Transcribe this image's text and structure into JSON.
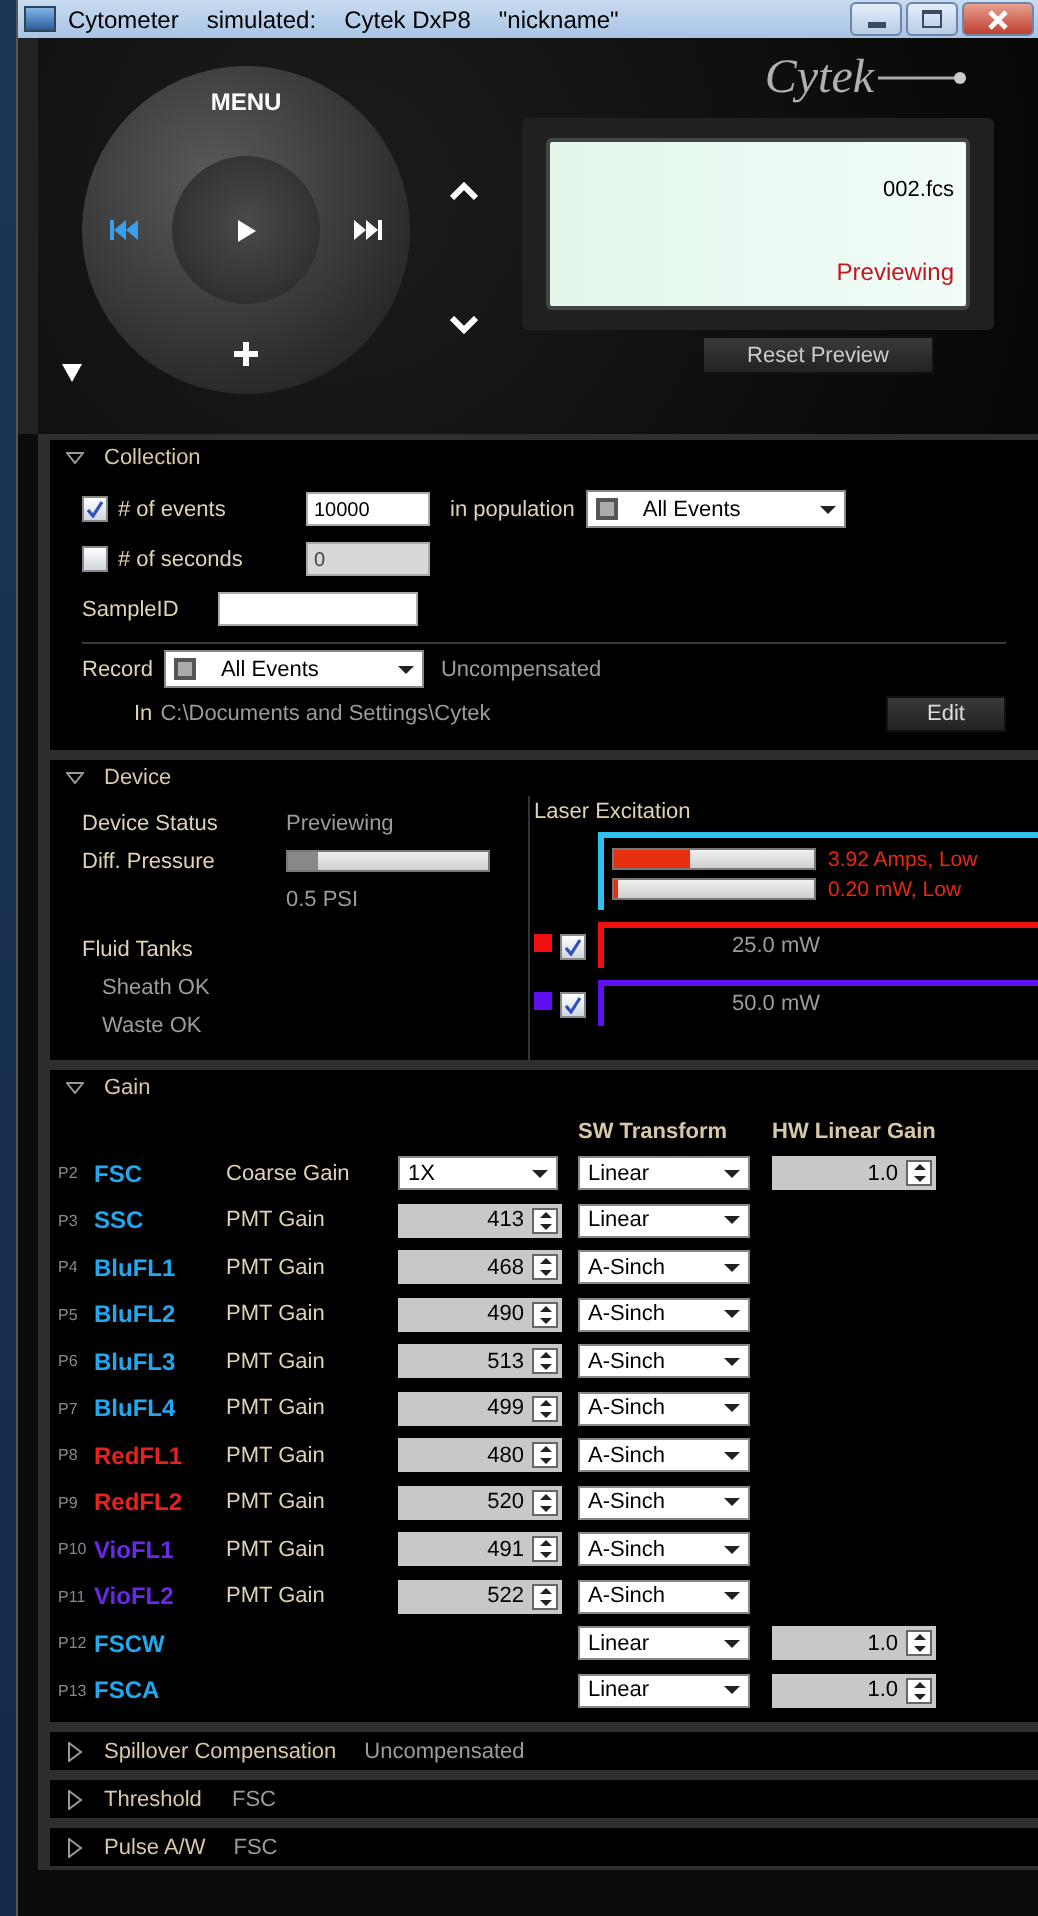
{
  "window": {
    "title": "Cytometer",
    "subtitle": [
      "simulated:",
      "Cytek DxP8",
      "\"nickname\""
    ]
  },
  "player": {
    "menu": "MENU",
    "logo": "Cytek",
    "display": {
      "file": "002.fcs",
      "status": "Previewing"
    },
    "reset_button": "Reset Preview"
  },
  "collection": {
    "title": "Collection",
    "expanded": true,
    "events": {
      "label": "# of events",
      "checked": true,
      "value": "10000"
    },
    "population": {
      "label": "in population",
      "value": "All Events"
    },
    "seconds": {
      "label": "# of seconds",
      "checked": false,
      "value": "0"
    },
    "sample_id": {
      "label": "SampleID"
    },
    "record": {
      "label": "Record",
      "value": "All Events",
      "note": "Uncompensated"
    },
    "path": {
      "label": "In",
      "value": "C:\\Documents and Settings\\Cytek"
    },
    "edit_button": "Edit"
  },
  "device": {
    "title": "Device",
    "expanded": true,
    "status": {
      "label": "Device Status",
      "value": "Previewing"
    },
    "pressure": {
      "label": "Diff. Pressure",
      "level": 0.15,
      "reading": "0.5 PSI"
    },
    "fluid": {
      "label": "Fluid Tanks",
      "items": [
        "Sheath OK",
        "Waste OK"
      ]
    },
    "laser_title": "Laser Excitation",
    "lasers": [
      {
        "color": "#30c0f0",
        "bars": [
          {
            "level": 0.38,
            "reading": "3.92 Amps, Low"
          },
          {
            "level": 0.02,
            "reading": "0.20 mW, Low"
          }
        ]
      },
      {
        "color": "#f01010",
        "checked": true,
        "reading": "25.0 mW"
      },
      {
        "color": "#6010f0",
        "checked": true,
        "reading": "50.0 mW"
      }
    ]
  },
  "gain": {
    "title": "Gain",
    "expanded": true,
    "headers": {
      "transform": "SW Transform",
      "linear": "HW Linear Gain"
    },
    "rows": [
      {
        "param": "P2",
        "name": "FSC",
        "color": "#20a8f0",
        "gain_label": "Coarse Gain",
        "kind": "dropdown",
        "gain_value": "1X",
        "transform": "Linear",
        "linear_gain": "1.0"
      },
      {
        "param": "P3",
        "name": "SSC",
        "color": "#20a8f0",
        "gain_label": "PMT Gain",
        "kind": "spin",
        "gain_value": "413",
        "transform": "Linear"
      },
      {
        "param": "P4",
        "name": "BluFL1",
        "color": "#20a8f0",
        "gain_label": "PMT Gain",
        "kind": "spin",
        "gain_value": "468",
        "transform": "A-Sinch"
      },
      {
        "param": "P5",
        "name": "BluFL2",
        "color": "#20a8f0",
        "gain_label": "PMT Gain",
        "kind": "spin",
        "gain_value": "490",
        "transform": "A-Sinch"
      },
      {
        "param": "P6",
        "name": "BluFL3",
        "color": "#20a8f0",
        "gain_label": "PMT Gain",
        "kind": "spin",
        "gain_value": "513",
        "transform": "A-Sinch"
      },
      {
        "param": "P7",
        "name": "BluFL4",
        "color": "#20a8f0",
        "gain_label": "PMT Gain",
        "kind": "spin",
        "gain_value": "499",
        "transform": "A-Sinch"
      },
      {
        "param": "P8",
        "name": "RedFL1",
        "color": "#e82020",
        "gain_label": "PMT Gain",
        "kind": "spin",
        "gain_value": "480",
        "transform": "A-Sinch"
      },
      {
        "param": "P9",
        "name": "RedFL2",
        "color": "#e82020",
        "gain_label": "PMT Gain",
        "kind": "spin",
        "gain_value": "520",
        "transform": "A-Sinch"
      },
      {
        "param": "P10",
        "name": "VioFL1",
        "color": "#6a28e8",
        "gain_label": "PMT Gain",
        "kind": "spin",
        "gain_value": "491",
        "transform": "A-Sinch"
      },
      {
        "param": "P11",
        "name": "VioFL2",
        "color": "#6a28e8",
        "gain_label": "PMT Gain",
        "kind": "spin",
        "gain_value": "522",
        "transform": "A-Sinch"
      },
      {
        "param": "P12",
        "name": "FSCW",
        "color": "#20a8f0",
        "transform": "Linear",
        "linear_gain": "1.0"
      },
      {
        "param": "P13",
        "name": "FSCA",
        "color": "#20a8f0",
        "transform": "Linear",
        "linear_gain": "1.0"
      }
    ]
  },
  "collapsed": [
    {
      "title": "Spillover Compensation",
      "value": "Uncompensated",
      "expanded": false
    },
    {
      "title": "Threshold",
      "value": "FSC",
      "expanded": false
    },
    {
      "title": "Pulse A/W",
      "value": "FSC",
      "expanded": false
    }
  ]
}
